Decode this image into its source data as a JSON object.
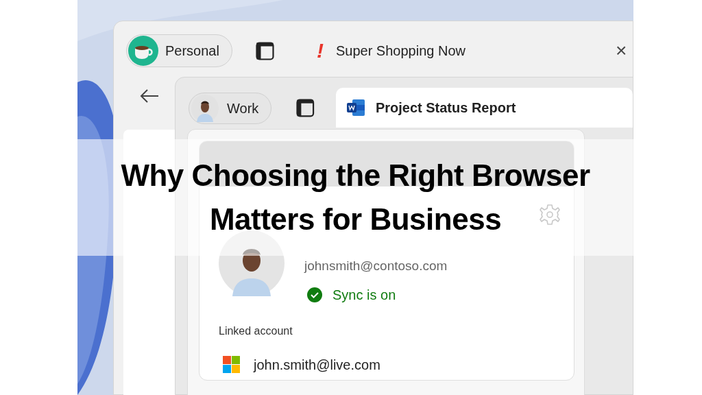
{
  "back_window": {
    "profile": {
      "label": "Personal"
    },
    "tab": {
      "alert": "!",
      "title": "Super Shopping Now",
      "selected": false
    },
    "close": "×"
  },
  "front_window": {
    "profile": {
      "label": "Work"
    },
    "tab": {
      "title": "Project Status Report",
      "selected": true
    }
  },
  "profile_flyout": {
    "email": "johnsmith@contoso.com",
    "sync": {
      "on": true,
      "label": "Sync is on"
    },
    "linked_account": {
      "heading": "Linked account",
      "email": "john.smith@live.com"
    }
  },
  "headline": {
    "lines": [
      "Why Choosing the Right Browser",
      "Matters for Business"
    ]
  }
}
